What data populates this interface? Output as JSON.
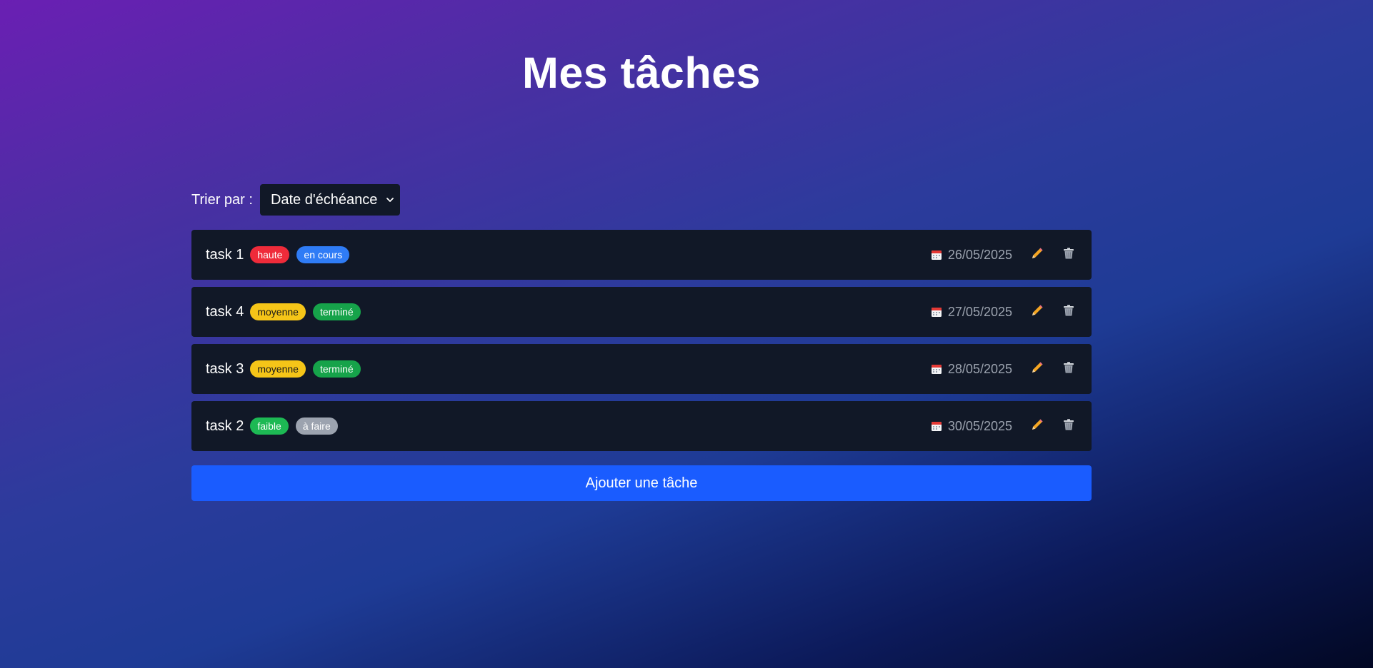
{
  "page": {
    "title": "Mes tâches"
  },
  "sort": {
    "label": "Trier par :",
    "selected": "Date d'échéance"
  },
  "colors": {
    "row_bg": "#111827",
    "date_text": "#9ca3af",
    "add_button": "#1a5cff",
    "edit_icon": "#f5a623"
  },
  "tasks": [
    {
      "name": "task 1",
      "priority": {
        "label": "haute",
        "color": "#ef2b3a",
        "text_color": "#ffffff"
      },
      "status": {
        "label": "en cours",
        "color": "#2f7cf6",
        "text_color": "#ffffff"
      },
      "due_date": "26/05/2025"
    },
    {
      "name": "task 4",
      "priority": {
        "label": "moyenne",
        "color": "#f5c518",
        "text_color": "#1a1a1a"
      },
      "status": {
        "label": "terminé",
        "color": "#16a34a",
        "text_color": "#ffffff"
      },
      "due_date": "27/05/2025"
    },
    {
      "name": "task 3",
      "priority": {
        "label": "moyenne",
        "color": "#f5c518",
        "text_color": "#1a1a1a"
      },
      "status": {
        "label": "terminé",
        "color": "#16a34a",
        "text_color": "#ffffff"
      },
      "due_date": "28/05/2025"
    },
    {
      "name": "task 2",
      "priority": {
        "label": "faible",
        "color": "#1db954",
        "text_color": "#ffffff"
      },
      "status": {
        "label": "à faire",
        "color": "#9ca3af",
        "text_color": "#ffffff"
      },
      "due_date": "30/05/2025"
    }
  ],
  "icons": {
    "calendar": "calendar-icon",
    "edit": "pencil-icon",
    "delete": "trash-icon",
    "dropdown": "chevron-down-icon"
  },
  "add_button": {
    "label": "Ajouter une tâche"
  }
}
